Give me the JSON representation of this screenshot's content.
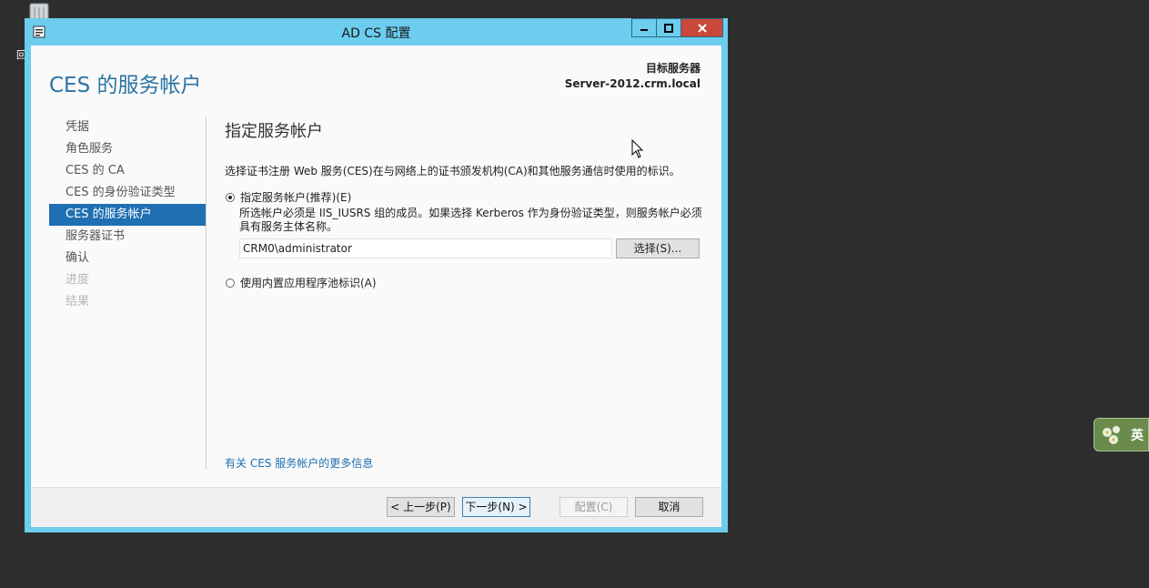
{
  "desktop": {
    "recycle_label": "回"
  },
  "window": {
    "title": "AD CS 配置"
  },
  "header": {
    "page_title": "CES 的服务帐户",
    "target_label": "目标服务器",
    "target_server": "Server-2012.crm.local"
  },
  "nav": {
    "items": [
      {
        "label": "凭据",
        "state": "normal"
      },
      {
        "label": "角色服务",
        "state": "normal"
      },
      {
        "label": "CES 的 CA",
        "state": "normal"
      },
      {
        "label": "CES 的身份验证类型",
        "state": "normal"
      },
      {
        "label": "CES 的服务帐户",
        "state": "active"
      },
      {
        "label": "服务器证书",
        "state": "normal"
      },
      {
        "label": "确认",
        "state": "normal"
      },
      {
        "label": "进度",
        "state": "disabled"
      },
      {
        "label": "结果",
        "state": "disabled"
      }
    ]
  },
  "content": {
    "section_title": "指定服务帐户",
    "description": "选择证书注册 Web 服务(CES)在与网络上的证书颁发机构(CA)和其他服务通信时使用的标识。",
    "option_specify": {
      "label": "指定服务帐户(推荐)(E)",
      "checked": true,
      "note": "所选帐户必须是 IIS_IUSRS 组的成员。如果选择 Kerberos 作为身份验证类型，则服务帐户必须具有服务主体名称。",
      "account_value": "CRM0\\administrator",
      "select_label": "选择(S)..."
    },
    "option_builtin": {
      "label": "使用内置应用程序池标识(A)",
      "checked": false
    },
    "more_link": "有关 CES 服务帐户的更多信息"
  },
  "footer": {
    "prev_label": "< 上一步(P)",
    "next_label": "下一步(N) >",
    "configure_label": "配置(C)",
    "cancel_label": "取消"
  },
  "ime": {
    "label": "英"
  }
}
